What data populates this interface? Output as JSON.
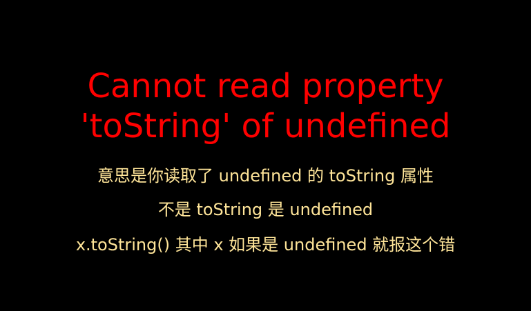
{
  "colors": {
    "background": "#000000",
    "title": "#ff0000",
    "subtitle": "#ffe599"
  },
  "title": {
    "line1": "Cannot read property",
    "line2": "'toString' of undefined"
  },
  "subtitles": [
    "意思是你读取了 undefined 的 toString 属性",
    "不是 toString 是 undefined",
    "x.toString() 其中 x 如果是 undefined 就报这个错"
  ]
}
